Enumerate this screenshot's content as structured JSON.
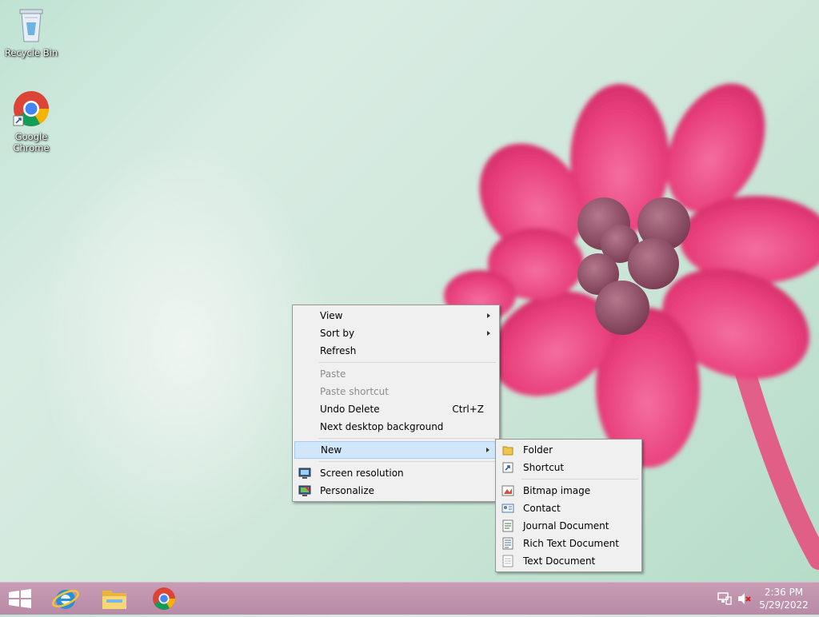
{
  "desktop": {
    "icons": [
      {
        "label": "Recycle Bin",
        "icon": "recycle-bin-icon"
      },
      {
        "label": "Google Chrome",
        "icon": "chrome-icon"
      }
    ]
  },
  "context_menu": {
    "items": [
      {
        "label": "View",
        "submenu": true
      },
      {
        "label": "Sort by",
        "submenu": true
      },
      {
        "label": "Refresh"
      },
      {
        "label": "Paste",
        "disabled": true
      },
      {
        "label": "Paste shortcut",
        "disabled": true
      },
      {
        "label": "Undo Delete",
        "shortcut": "Ctrl+Z"
      },
      {
        "label": "Next desktop background"
      },
      {
        "label": "New",
        "submenu": true,
        "highlighted": true
      },
      {
        "label": "Screen resolution",
        "icon": "screen-resolution-icon"
      },
      {
        "label": "Personalize",
        "icon": "personalize-icon"
      }
    ]
  },
  "new_submenu": {
    "items": [
      {
        "label": "Folder",
        "icon": "folder-icon"
      },
      {
        "label": "Shortcut",
        "icon": "shortcut-icon"
      },
      {
        "label": "Bitmap image",
        "icon": "bitmap-icon"
      },
      {
        "label": "Contact",
        "icon": "contact-icon"
      },
      {
        "label": "Journal Document",
        "icon": "journal-icon"
      },
      {
        "label": "Rich Text Document",
        "icon": "rich-text-icon"
      },
      {
        "label": "Text Document",
        "icon": "text-document-icon"
      }
    ]
  },
  "taskbar": {
    "apps": [
      "start-icon",
      "internet-explorer-icon",
      "file-explorer-icon",
      "chrome-icon"
    ],
    "tray": {
      "time": "2:36 PM",
      "date": "5/29/2022",
      "icons": [
        "network-icon",
        "volume-muted-icon"
      ]
    }
  },
  "colors": {
    "taskbar": "#c399b1",
    "menu_bg": "#f0f0f0",
    "highlight": "#d2e6f9",
    "flower": "#e8477f"
  }
}
